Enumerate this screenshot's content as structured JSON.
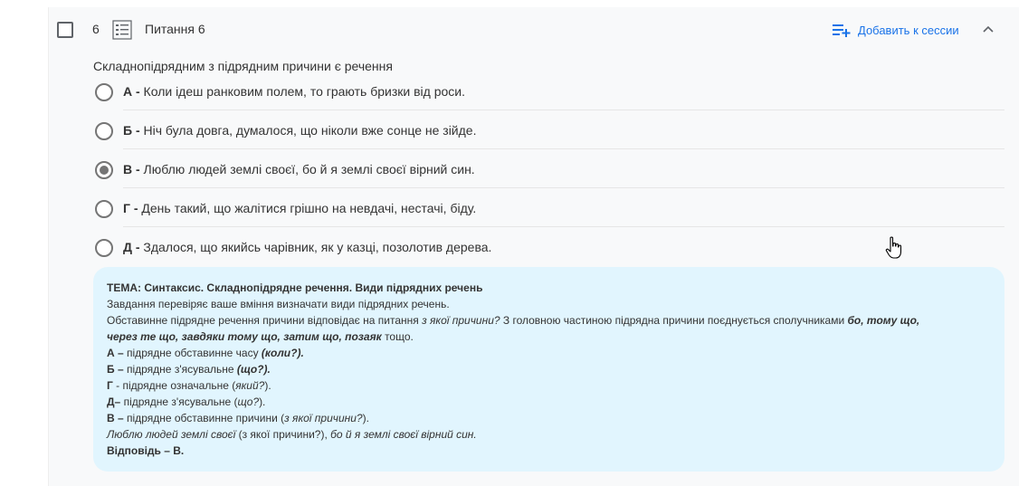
{
  "header": {
    "number": "6",
    "title": "Питання 6",
    "add_session_label": "Добавить к сессии",
    "list_icon": "list-icon",
    "add_icon": "playlist-add-icon",
    "collapse_icon": "chevron-up-icon"
  },
  "question": {
    "text": "Складнопідрядним з підрядним причини є речення",
    "options": [
      {
        "letter": "А -",
        "text": " Коли ідеш ранковим полем, то грають бризки від роси."
      },
      {
        "letter": "Б -",
        "text": " Ніч була довга, думалося, що ніколи вже сонце не зійде."
      },
      {
        "letter": "В -",
        "text": " Люблю людей землі своєї, бо й я землі своєї вірний син."
      },
      {
        "letter": "Г -",
        "text": " День такий, що жалітися грішно на невдачі, нестачі, біду."
      },
      {
        "letter": "Д -",
        "text": " Здалося, що якийсь чарівник, як у казці, позолотив дерева."
      }
    ],
    "selected_index": 2
  },
  "explanation": {
    "topic": "ТЕМА: Синтаксис. Складнопідрядне речення. Види підрядних речень",
    "line1": "Завдання перевіряє ваше вміння визначати види підрядних речень.",
    "line2a": "Обставинне підрядне речення причини відповідає на питання ",
    "line2b": "з якої причини?",
    "line2c": " З головною частиною підрядна причини поєднується сполучниками ",
    "line2d": "бо, тому що,",
    "line3a": "через те що, завдяки тому що, затим що, позаяк",
    "line3b": " тощо.",
    "a1": "А –",
    "a2": " підрядне обставинне часу ",
    "a3": "(коли?).",
    "b1": "Б –",
    "b2": " підрядне з'ясувальне ",
    "b3": "(що?).",
    "g1": "Г",
    "g2": " - підрядне означальне (",
    "g3": "який?",
    "g4": ").",
    "d1": "Д–",
    "d2": " підрядне з'ясувальне (",
    "d3": "що?",
    "d4": ").",
    "v1": "В –",
    "v2": " підрядне обставинне причини (",
    "v3": "з якої причини?",
    "v4": ").",
    "ex1": "Люблю людей землі своєї",
    "ex2": " (з якої причини?), ",
    "ex3": "бо й я землі своєї вірний син.",
    "answer": "Відповідь – В."
  },
  "colors": {
    "accent": "#1a73e8",
    "explanation_bg": "#e1f5fe",
    "radio": "#757575"
  }
}
